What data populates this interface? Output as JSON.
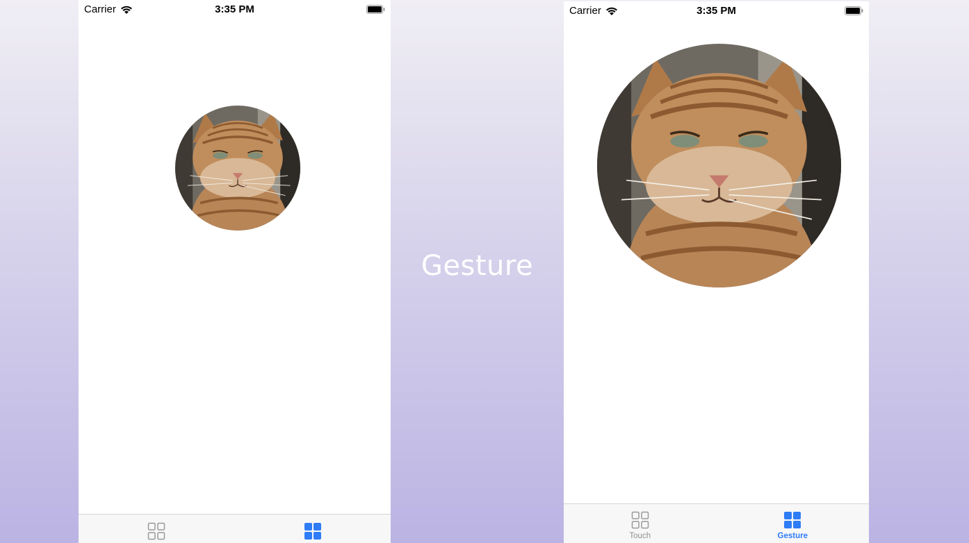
{
  "center_caption": "Gesture",
  "status_bar": {
    "carrier": "Carrier",
    "time": "3:35 PM"
  },
  "tabs": [
    {
      "label": "Touch",
      "icon": "grid-outline-icon",
      "active": false
    },
    {
      "label": "Gesture",
      "icon": "grid-filled-icon",
      "active": true
    }
  ],
  "colors": {
    "accent": "#2e7cf6",
    "inactive": "#8e8e93",
    "tab_bar_bg": "#f7f7f7"
  }
}
